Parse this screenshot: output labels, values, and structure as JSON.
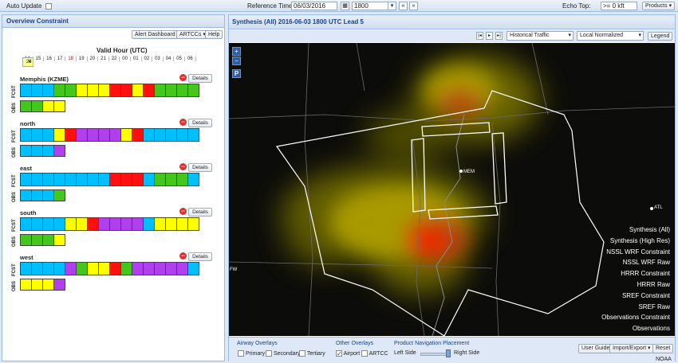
{
  "topbar": {
    "auto_update_label": "Auto Update",
    "reference_time_label": "Reference Time:",
    "date_value": "06/03/2016",
    "time_value": "1800",
    "echo_top_label": "Echo Top:",
    "echo_top_value": ">= 0 kft",
    "products_label": "Products"
  },
  "left": {
    "title": "Overview Constraint",
    "buttons": {
      "alert": "Alert Dashboard",
      "artcc": "ARTCCs",
      "help": "Help"
    },
    "valid_hour_label": "Valid Hour (UTC)",
    "hours": [
      "14",
      "15",
      "16",
      "17",
      "18",
      "19",
      "20",
      "21",
      "22",
      "23",
      "00",
      "01",
      "02",
      "03",
      "04",
      "05",
      "06"
    ],
    "hour_red": "18",
    "hour_selected": "23",
    "fcst_label": "FCST",
    "obs_label": "OBS",
    "details_label": "Details",
    "colors": {
      "b": "#00bfff",
      "g": "#44c61c",
      "y": "#ffff00",
      "p": "#b040ee",
      "r": "#ff1010"
    },
    "groups": [
      {
        "name": "Memphis (KZME)",
        "fcst": "bbbggyyyrryrggggbb",
        "obs": "ggyy"
      },
      {
        "name": "north",
        "fcst": "bbbyrppppyrbbbbbbb",
        "obs": "bbbp"
      },
      {
        "name": "east",
        "fcst": "bbbbbbbbrrrbgggbbb",
        "obs": "bbbg"
      },
      {
        "name": "south",
        "fcst": "bbbbyyrppppbyyyybbb",
        "obs": "gggy"
      },
      {
        "name": "west",
        "fcst": "bbbbpgyyrgpppppbbyyy",
        "obs": "yyyp"
      }
    ]
  },
  "right": {
    "title": "Synthesis (All) 2016-06-03 1800 UTC Lead 5",
    "traffic_select": "Historical Traffic",
    "normalize_select": "Local Normalized",
    "legend_label": "Legend",
    "map_labels": {
      "mem": "MEM",
      "atl": "ATL",
      "fw": "FW"
    },
    "products": [
      "Synthesis (All)",
      "Synthesis (High Res)",
      "NSSL WRF Constraint",
      "NSSL WRF Raw",
      "HRRR Constraint",
      "HRRR Raw",
      "SREF Constraint",
      "SREF Raw",
      "Observations Constraint",
      "Observations"
    ],
    "airway_overlays_label": "Airway Overlays",
    "airway_options": [
      "Primary",
      "Secondary",
      "Tertiary"
    ],
    "other_overlays_label": "Other Overlays",
    "other_options": [
      "Airport",
      "ARTCC"
    ],
    "placement_label": "Product Navigation Placement",
    "left_side": "Left Side",
    "right_side": "Right Side",
    "user_guide": "User Guide",
    "import_export": "Import/Export",
    "reset": "Reset",
    "noaa": "NOAA"
  }
}
